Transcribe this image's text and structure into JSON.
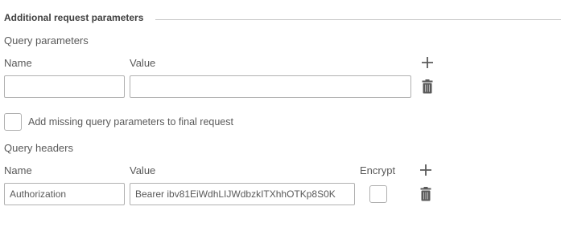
{
  "section": {
    "title": "Additional request parameters"
  },
  "query_params": {
    "heading": "Query parameters",
    "name_label": "Name",
    "value_label": "Value",
    "rows": [
      {
        "name": "",
        "value": ""
      }
    ]
  },
  "missing_params": {
    "label": "Add missing query parameters to final request",
    "checked": false
  },
  "query_headers": {
    "heading": "Query headers",
    "name_label": "Name",
    "value_label": "Value",
    "encrypt_label": "Encrypt",
    "rows": [
      {
        "name": "Authorization",
        "value": "Bearer ibv81EiWdhLIJWdbzkITXhhOTKp8S0K",
        "encrypt": false
      }
    ]
  },
  "icons": {
    "add": "plus-icon",
    "delete": "trash-icon"
  },
  "colors": {
    "text": "#595959",
    "border": "#b0b0b0",
    "rule": "#c9c9c9",
    "icon": "#595959"
  }
}
